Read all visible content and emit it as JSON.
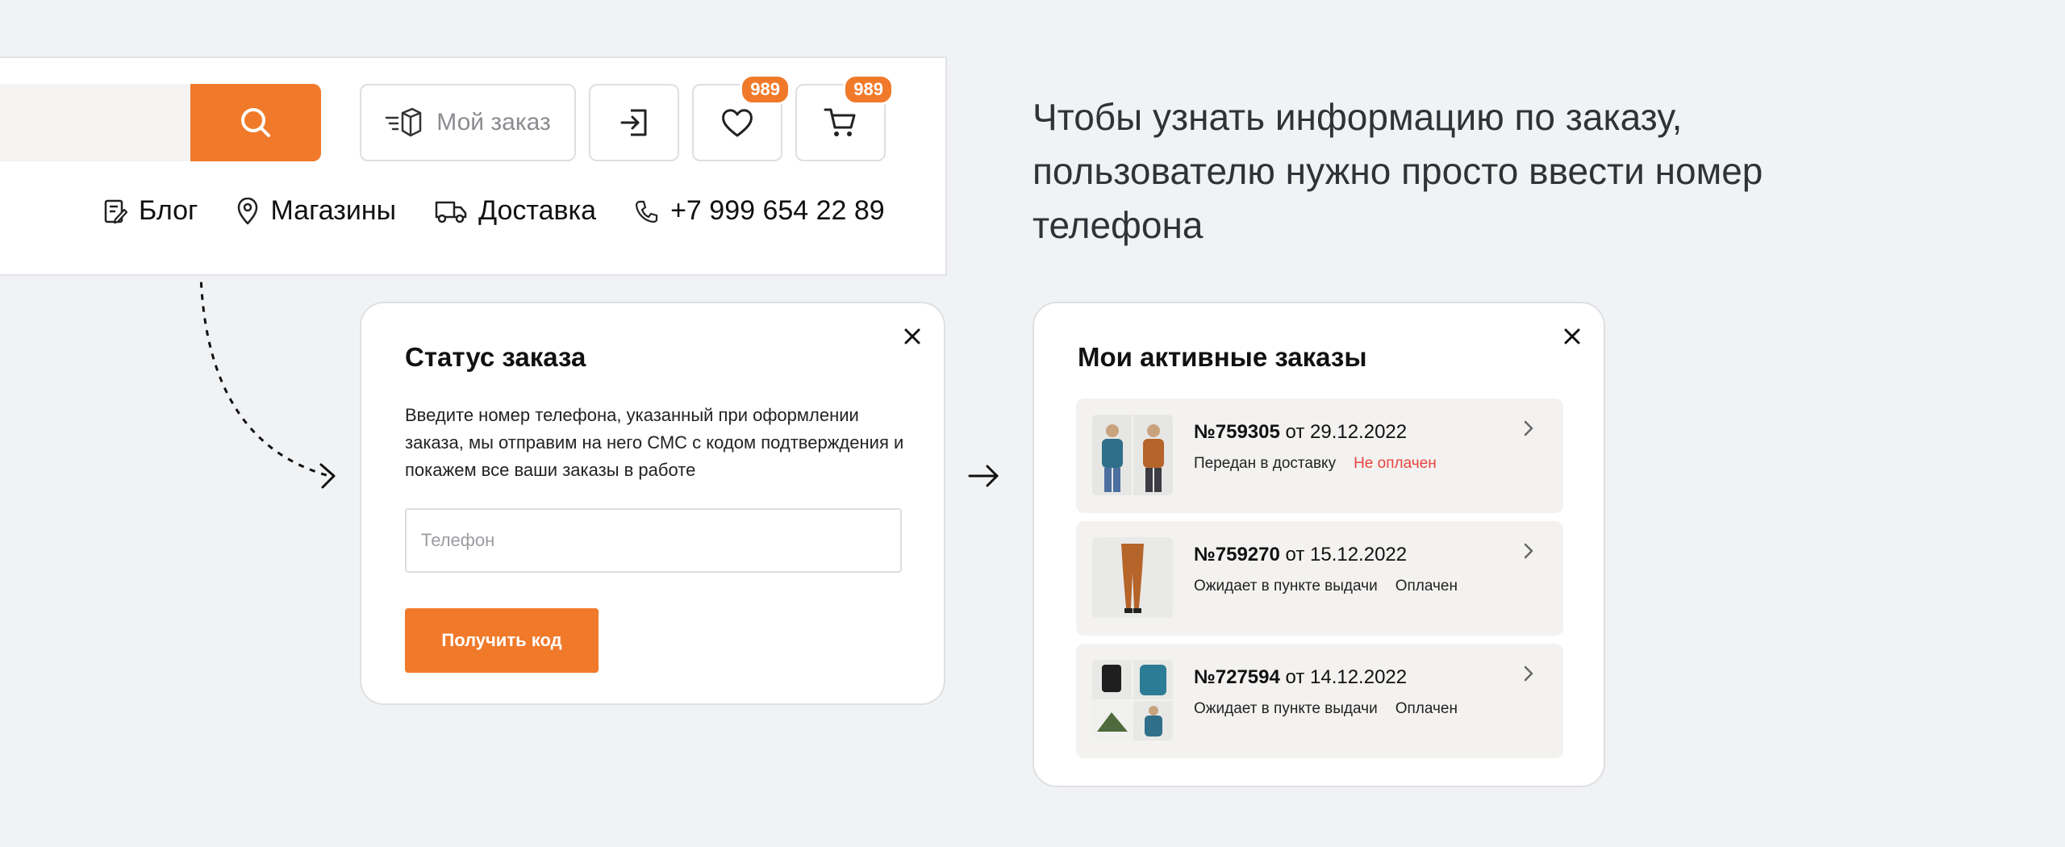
{
  "header": {
    "my_order_label": "Мой заказ",
    "favorites_count": "989",
    "cart_count": "989",
    "nav": [
      {
        "label": "Блог",
        "icon": "blog-icon"
      },
      {
        "label": "Магазины",
        "icon": "map-pin-icon"
      },
      {
        "label": "Доставка",
        "icon": "truck-icon"
      },
      {
        "label": "+7 999 654 22 89",
        "icon": "phone-icon"
      }
    ]
  },
  "intro": {
    "text": "Чтобы узнать информацию по заказу, пользователю нужно просто ввести номер телефона"
  },
  "status_modal": {
    "title": "Статус заказа",
    "description": "Введите номер телефона, указанный при оформлении заказа, мы отправим на него СМС с кодом подтверждения и покажем все ваши заказы в работе",
    "phone_placeholder": "Телефон",
    "button_label": "Получить код"
  },
  "orders_modal": {
    "title": "Мои активные заказы",
    "orders": [
      {
        "number": "№759305",
        "date": "от 29.12.2022",
        "status": "Передан в доставку",
        "payment": "Не оплачен"
      },
      {
        "number": "№759270",
        "date": "от 15.12.2022",
        "status": "Ожидает в пункте выдачи",
        "payment": "Оплачен"
      },
      {
        "number": "№727594",
        "date": "от 14.12.2022",
        "status": "Ожидает в пункте выдачи",
        "payment": "Оплачен"
      }
    ]
  },
  "colors": {
    "accent": "#f07a2a",
    "unpaid": "#e8443f",
    "background": "#f1f2f4"
  }
}
